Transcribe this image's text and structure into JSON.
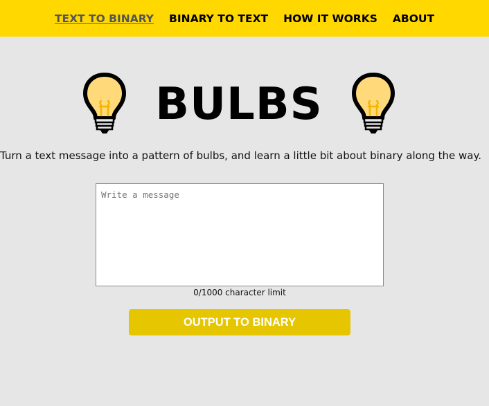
{
  "nav": {
    "items": [
      {
        "label": "TEXT TO BINARY",
        "active": true
      },
      {
        "label": "BINARY TO TEXT",
        "active": false
      },
      {
        "label": "HOW IT WORKS",
        "active": false
      },
      {
        "label": "ABOUT",
        "active": false
      }
    ]
  },
  "hero": {
    "title": "BULBS",
    "left_icon": "lightbulb-icon",
    "right_icon": "lightbulb-icon"
  },
  "tagline": "Turn a text message into a pattern of bulbs, and learn a little bit about binary along the way.",
  "message": {
    "value": "",
    "placeholder": "Write a message",
    "char_limit_text": "0/1000 character limit"
  },
  "output_button": {
    "label": "OUTPUT TO BINARY"
  },
  "colors": {
    "navbar_bg": "#ffd800",
    "page_bg": "#e6e6e6",
    "button_bg": "#e5c600",
    "bulb_fill": "#ffd97a",
    "filament": "#f2b600"
  }
}
